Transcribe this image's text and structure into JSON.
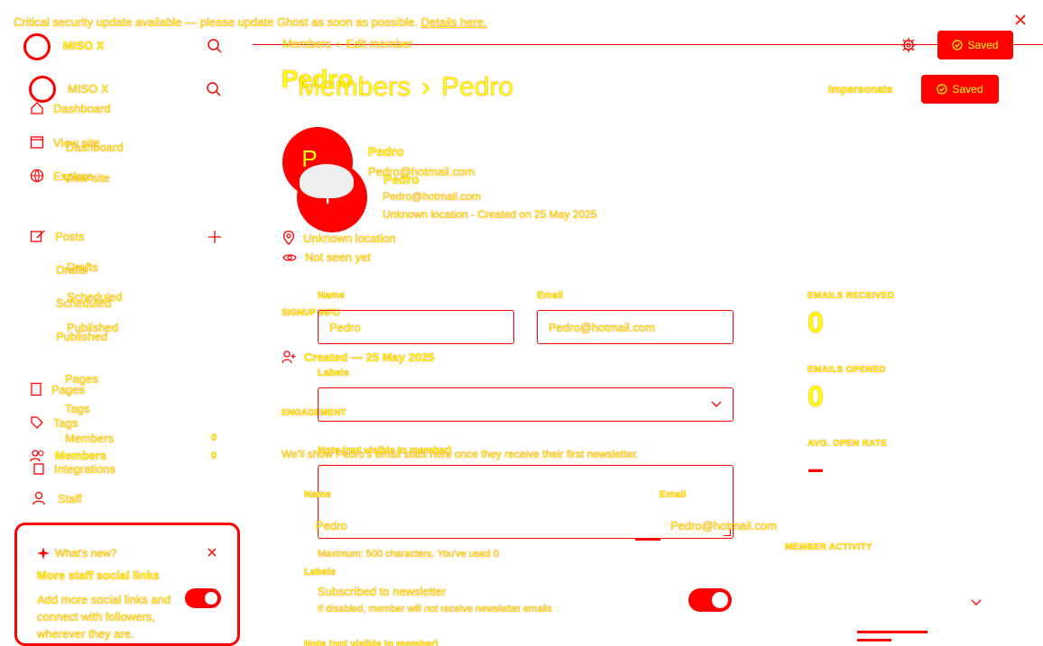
{
  "banner": {
    "text": "Critical security update available — please update Ghost as soon as possible.",
    "link": "Details here."
  },
  "header": {
    "breadcrumb_parent": "Members",
    "breadcrumb_separator": "›",
    "breadcrumb_current": "Edit member",
    "save_label": "Saved"
  },
  "sidebar": {
    "site_name": "MISO X",
    "site_name_dup": "MISO X",
    "items": [
      {
        "label": "Dashboard"
      },
      {
        "label": "View site"
      },
      {
        "label": "Explore"
      },
      {
        "label": "Posts"
      }
    ],
    "dup_items": [
      {
        "label": "Dashboard"
      },
      {
        "label": "View site"
      }
    ],
    "post_subitems": [
      {
        "label": "Drafts"
      },
      {
        "label": "Scheduled"
      },
      {
        "label": "Published"
      }
    ],
    "post_subitems_dup": [
      {
        "label": "Drafts"
      },
      {
        "label": "Scheduled"
      },
      {
        "label": "Published"
      }
    ],
    "lower_items": [
      {
        "label": "Pages"
      },
      {
        "label": "Tags"
      },
      {
        "label": "Members",
        "count": "0"
      },
      {
        "label": "Integrations"
      },
      {
        "label": "Staff"
      }
    ],
    "lower_items_dup": [
      {
        "label": "Pages"
      },
      {
        "label": "Tags"
      },
      {
        "label": "Members",
        "count": "0"
      }
    ],
    "whats_new": {
      "heading": "What's new?",
      "title": "More staff social links",
      "body_line1": "Add more social links and",
      "body_line2": "connect with followers,",
      "body_line3": "wherever they are."
    }
  },
  "main": {
    "title_parent": "Members",
    "title_separator": "›",
    "title_current": "Pedro",
    "title_ghost": "Pedro",
    "impersonate_label": "Impersonate",
    "save_label": "Saved",
    "member": {
      "avatar_letter": "P",
      "avatar_letter_dup": "P",
      "name": "Pedro",
      "email": "Pedro@hotmail.com",
      "name_dup": "Pedro",
      "email_dup": "Pedro@hotmail.com",
      "meta_line": "Unknown location - Created on 25 May 2025",
      "location": "Unknown location",
      "seen": "Not seen yet"
    },
    "signup_info": "SIGNUP INFO",
    "created": "Created — 25 May 2025",
    "engagement": "ENGAGEMENT",
    "engagement_note": "We'll show Pedro's email stats here once they receive their first newsletter.",
    "form": {
      "name_label": "Name",
      "name_value": "Pedro",
      "email_label": "Email",
      "email_value": "Pedro@hotmail.com",
      "labels_label": "Labels",
      "note_label": "Note (not visible to member)",
      "note_counter": "Maximum: 500 characters. You've used 0",
      "newsletter_title": "Subscribed to newsletter",
      "newsletter_desc_pre": "If disabled, member will ",
      "newsletter_desc_em": "not",
      "newsletter_desc_post": " receive newsletter emails"
    },
    "form_dup": {
      "name_label": "Name",
      "name_value": "Pedro",
      "email_label": "Email",
      "email_value": "Pedro@hotmail.com",
      "labels_label": "Labels",
      "note_label": "Note (not visible to member)"
    },
    "stats": {
      "emails_received_label": "EMAILS RECEIVED",
      "emails_received_value": "0",
      "emails_opened_label": "EMAILS OPENED",
      "emails_opened_value": "0",
      "open_rate_label": "AVG. OPEN RATE",
      "open_rate_value": "–",
      "member_activity_label": "MEMBER ACTIVITY"
    }
  },
  "colors": {
    "accent": "#ff0000",
    "highlight": "#ffff00",
    "background": "#ffffff"
  }
}
